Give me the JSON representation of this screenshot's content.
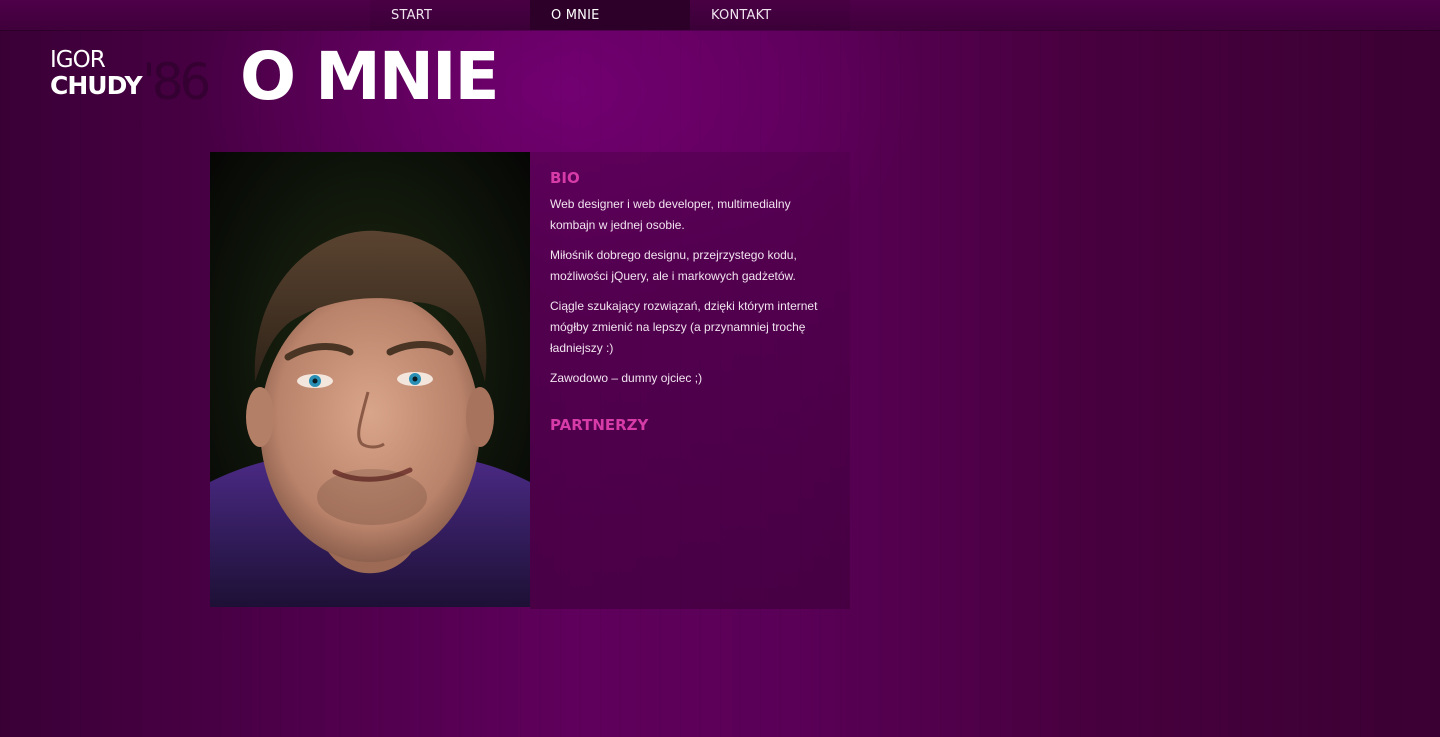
{
  "nav": {
    "items": [
      {
        "label": "START",
        "active": false
      },
      {
        "label": "O MNIE",
        "active": true
      },
      {
        "label": "KONTAKT",
        "active": false
      }
    ]
  },
  "logo": {
    "first_name": "IGOR",
    "last_name": "CHUDY",
    "year": "'86"
  },
  "page": {
    "title": "O MNIE"
  },
  "bio": {
    "heading": "BIO",
    "paragraphs": [
      "Web designer i web developer, multimedialny kombajn w jednej osobie.",
      "Miłośnik dobrego designu, przejrzystego kodu, możliwości jQuery, ale i markowych gadżetów.",
      "Ciągle szukający rozwiązań, dzięki którym internet mógłby zmienić na lepszy (a przynamniej trochę ładniejszy :)",
      "Zawodowo – dumny ojciec ;)"
    ]
  },
  "partners": {
    "heading": "PARTNERZY"
  },
  "colors": {
    "background": "#4d0049",
    "nav_active": "#2c0028",
    "heading_accent": "#d63ba8",
    "body_text": "#f2e4f0"
  }
}
